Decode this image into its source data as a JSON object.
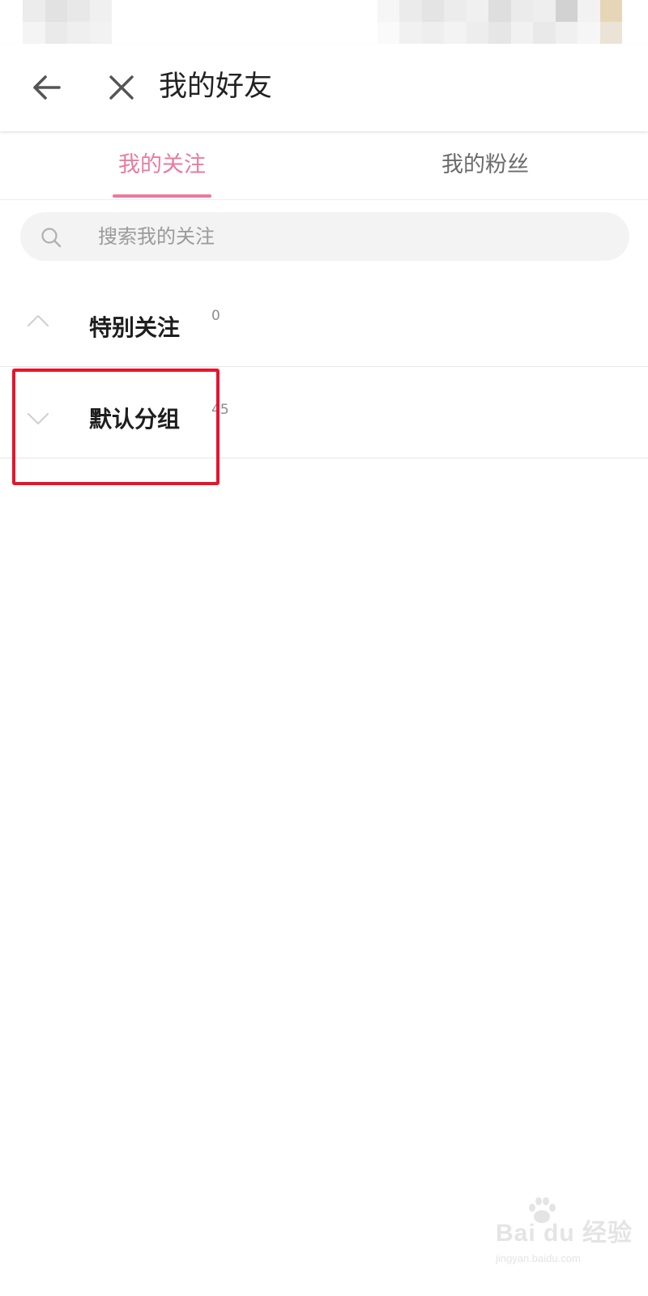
{
  "header": {
    "title": "我的好友",
    "back_icon": "arrow-left-icon",
    "close_icon": "close-icon"
  },
  "tabs": [
    {
      "label": "我的关注",
      "active": true
    },
    {
      "label": "我的粉丝",
      "active": false
    }
  ],
  "search": {
    "placeholder": "搜索我的关注",
    "value": "",
    "icon": "search-icon"
  },
  "groups": [
    {
      "name": "特别关注",
      "count": "0",
      "expanded": true
    },
    {
      "name": "默认分组",
      "count": "45",
      "expanded": false
    }
  ],
  "colors": {
    "accent": "#ea7a9e",
    "highlight": "#e8142c"
  },
  "watermark": {
    "main": "Bai du 经验",
    "sub": "jingyan.baidu.com"
  }
}
